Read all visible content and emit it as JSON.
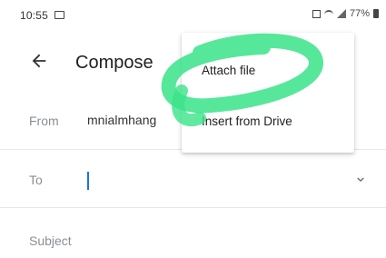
{
  "status_bar": {
    "time": "10:55",
    "battery": "77%"
  },
  "app_bar": {
    "title": "Compose",
    "back_icon": "arrow-left-icon"
  },
  "from": {
    "label": "From",
    "value": "mnialmhang"
  },
  "to": {
    "label": "To",
    "value": ""
  },
  "subject": {
    "placeholder": "Subject"
  },
  "menu": {
    "items": [
      {
        "label": "Attach file"
      },
      {
        "label": "Insert from Drive"
      }
    ]
  },
  "colors": {
    "caret": "#1a73e8",
    "highlight": "#39e38a",
    "label_gray": "#8a8f94"
  }
}
